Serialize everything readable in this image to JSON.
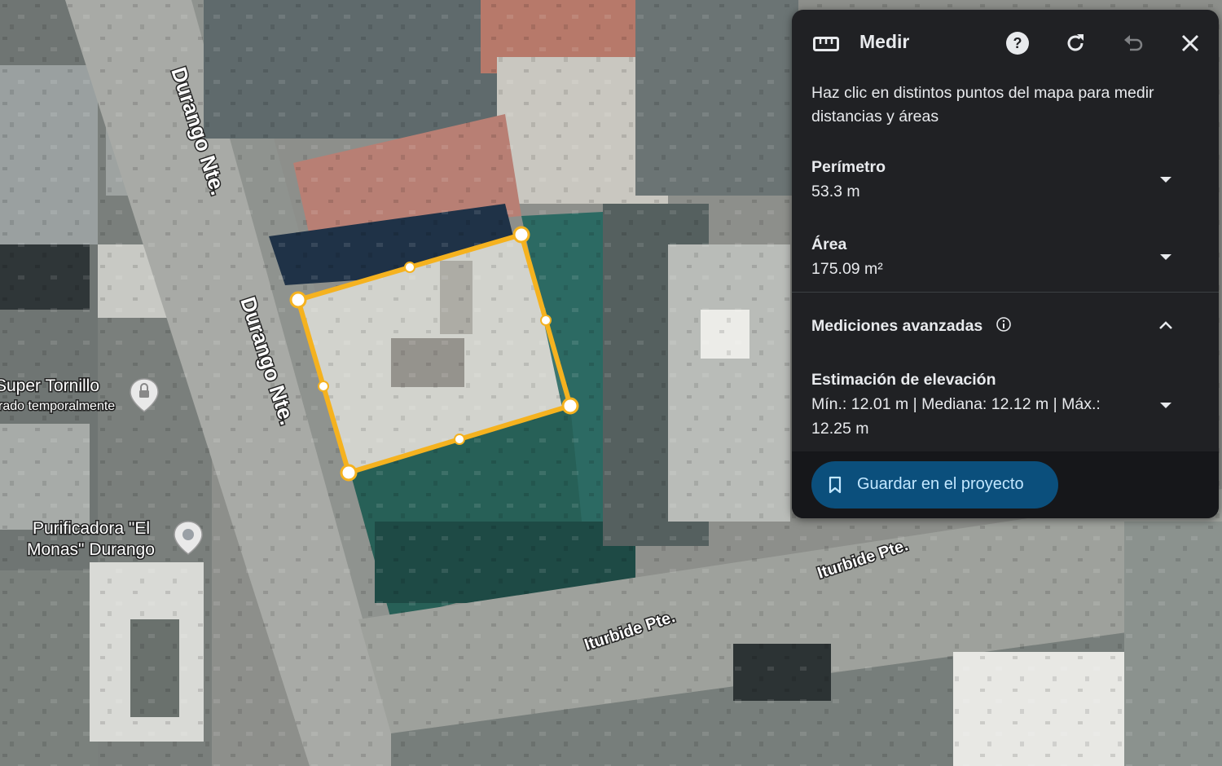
{
  "map": {
    "streets": [
      {
        "name": "Durango Nte."
      },
      {
        "name": "Durango Nte."
      },
      {
        "name": "Iturbide Pte."
      },
      {
        "name": "Iturbide Pte."
      }
    ],
    "pois": [
      {
        "line1": "Super Tornillo",
        "line2": "rado temporalmente",
        "icon": "lock-pin-icon"
      },
      {
        "line1": "Purificadora \"El",
        "line2": "Monas\" Durango",
        "icon": "location-pin-icon"
      }
    ],
    "polygon_color": "#f5b21f"
  },
  "panel": {
    "title": "Medir",
    "icons": {
      "ruler": "ruler-icon",
      "help": "help-icon",
      "redo": "redo-icon",
      "undo": "undo-icon",
      "close": "close-icon"
    },
    "instructions": "Haz clic en distintos puntos del mapa para medir distancias y áreas",
    "perimeter": {
      "label": "Perímetro",
      "value": "53.3 m"
    },
    "area": {
      "label": "Área",
      "value": "175.09 m²"
    },
    "advanced": {
      "label": "Mediciones avanzadas"
    },
    "elevation": {
      "label": "Estimación de elevación",
      "line1": "Mín.: 12.01 m | Mediana: 12.12 m | Máx.:",
      "line2": "12.25 m"
    },
    "save_label": "Guardar en el proyecto",
    "colors": {
      "panel_bg": "#202124",
      "button_bg": "#0b4f7c",
      "button_text": "#c2e7ff"
    }
  }
}
